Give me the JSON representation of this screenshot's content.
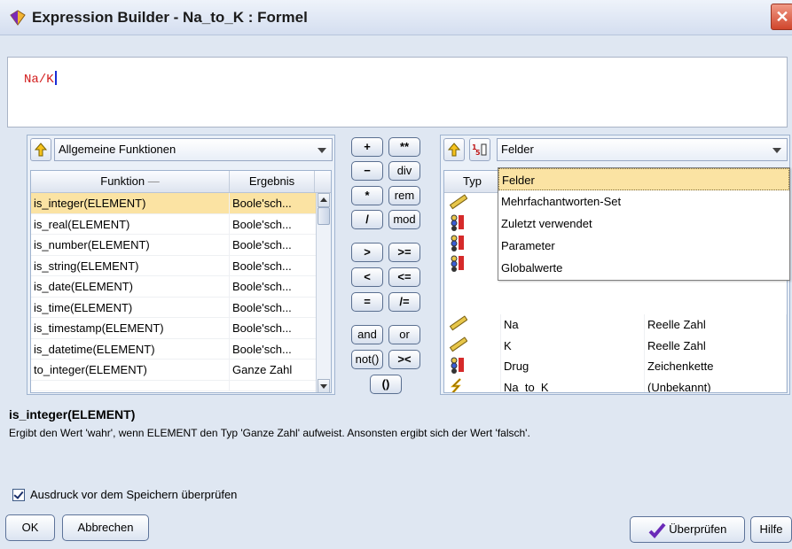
{
  "window": {
    "title": "Expression Builder - Na_to_K : Formel",
    "close_label": "✕"
  },
  "expression": {
    "value": "Na/K"
  },
  "functions_panel": {
    "category": "Allgemeine Funktionen",
    "columns": [
      "Funktion",
      "Ergebnis"
    ],
    "rows": [
      {
        "fn": "is_integer(ELEMENT)",
        "result": "Boole'sch..."
      },
      {
        "fn": "is_real(ELEMENT)",
        "result": "Boole'sch..."
      },
      {
        "fn": "is_number(ELEMENT)",
        "result": "Boole'sch..."
      },
      {
        "fn": "is_string(ELEMENT)",
        "result": "Boole'sch..."
      },
      {
        "fn": "is_date(ELEMENT)",
        "result": "Boole'sch..."
      },
      {
        "fn": "is_time(ELEMENT)",
        "result": "Boole'sch..."
      },
      {
        "fn": "is_timestamp(ELEMENT)",
        "result": "Boole'sch..."
      },
      {
        "fn": "is_datetime(ELEMENT)",
        "result": "Boole'sch..."
      },
      {
        "fn": "to_integer(ELEMENT)",
        "result": "Ganze Zahl"
      }
    ]
  },
  "operators": [
    "+",
    "**",
    "−",
    "div",
    "*",
    "rem",
    "/",
    "mod",
    ">",
    ">=",
    "<",
    "<=",
    "=",
    "/=",
    "and",
    "or",
    "not()",
    "><",
    "()"
  ],
  "fields_panel": {
    "selected_source": "Felder",
    "dropdown_options": [
      "Felder",
      "Mehrfachantworten-Set",
      "Zuletzt verwendet",
      "Parameter",
      "Globalwerte"
    ],
    "type_header": "Typ",
    "rows": [
      {
        "name": "Na",
        "type": "Reelle Zahl",
        "icon": "ruler-icon"
      },
      {
        "name": "K",
        "type": "Reelle Zahl",
        "icon": "ruler-icon"
      },
      {
        "name": "Drug",
        "type": "Zeichenkette",
        "icon": "set-icon"
      },
      {
        "name": "Na_to_K",
        "type": "(Unbekannt)",
        "icon": "lightning-icon"
      }
    ]
  },
  "description": {
    "title": "is_integer(ELEMENT)",
    "text": "Ergibt den Wert 'wahr', wenn ELEMENT den Typ 'Ganze Zahl' aufweist. Ansonsten ergibt sich der Wert 'falsch'."
  },
  "options": {
    "validate_label": "Ausdruck vor dem Speichern überprüfen",
    "validate_checked": true
  },
  "buttons": {
    "ok": "OK",
    "cancel": "Abbrechen",
    "check": "Überprüfen",
    "help": "Hilfe"
  }
}
